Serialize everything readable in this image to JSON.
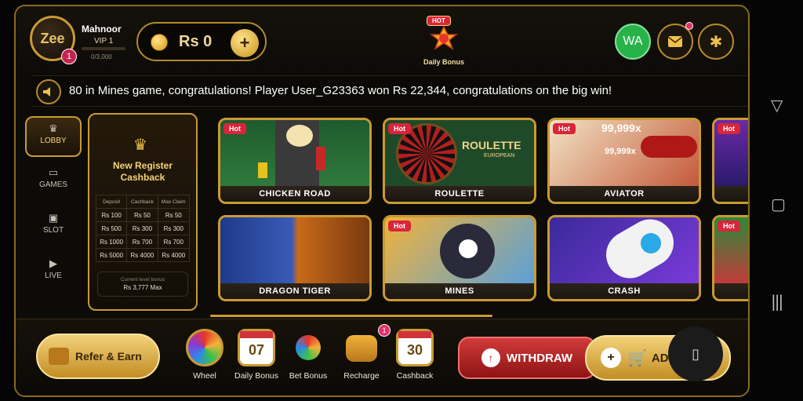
{
  "user": {
    "name": "Mahnoor",
    "vip": "VIP 1",
    "vip_progress": "0/3,000",
    "avatar_badge": "1",
    "avatar_logo": "Zee"
  },
  "wallet": {
    "balance": "Rs 0",
    "add_symbol": "+"
  },
  "daily_bonus": {
    "tag": "HOT",
    "label": "Daily Bonus"
  },
  "header_buttons": {
    "whatsapp": "WA"
  },
  "marquee": {
    "text": "80 in Mines game, congratulations! Player User_G23363 won Rs 22,344, congratulations on the big win!"
  },
  "sidenav": [
    {
      "label": "LOBBY",
      "icon": "crown-icon"
    },
    {
      "label": "GAMES",
      "icon": "gamepad-icon"
    },
    {
      "label": "SLOT",
      "icon": "slot-icon"
    },
    {
      "label": "LIVE",
      "icon": "play-icon"
    }
  ],
  "promo": {
    "title_line1": "New Register",
    "title_line2": "Cashback",
    "table": {
      "headers": [
        "Deposit",
        "Cashback",
        "Max Claim"
      ],
      "rows": [
        [
          "Rs 100",
          "Rs 50",
          "Rs 50"
        ],
        [
          "Rs 500",
          "Rs 300",
          "Rs 300"
        ],
        [
          "Rs 1000",
          "Rs 700",
          "Rs 700"
        ],
        [
          "Rs 5000",
          "Rs 4000",
          "Rs 4000"
        ]
      ]
    },
    "cap_label": "Current level bonus",
    "cap_value": "Rs 3,777 Max"
  },
  "games": [
    {
      "name": "CHICKEN ROAD",
      "hot": "Hot"
    },
    {
      "name": "ROULETTE",
      "hot": "Hot",
      "art_title": "ROULETTE",
      "art_sub": "EUROPEAN"
    },
    {
      "name": "AVIATOR",
      "hot": "Hot",
      "art_text": "99,999x",
      "art_text_top": "99,999x"
    },
    {
      "name": "",
      "hot": "Hot"
    },
    {
      "name": "DRAGON TIGER",
      "hot": ""
    },
    {
      "name": "MINES",
      "hot": "Hot"
    },
    {
      "name": "CRASH",
      "hot": ""
    },
    {
      "name": "",
      "hot": "Hot"
    }
  ],
  "bottom": {
    "refer": "Refer & Earn",
    "wheel": "Wheel",
    "daily_bonus": "Daily Bonus",
    "daily_day": "07",
    "bet_bonus": "Bet Bonus",
    "recharge": "Recharge",
    "recharge_badge": "1",
    "cashback": "Cashback",
    "cashback_day": "30",
    "withdraw": "WITHDRAW",
    "add": "AD"
  },
  "colors": {
    "gold": "#c99a33",
    "accent_red": "#d8253a",
    "whatsapp_green": "#27b24a"
  }
}
